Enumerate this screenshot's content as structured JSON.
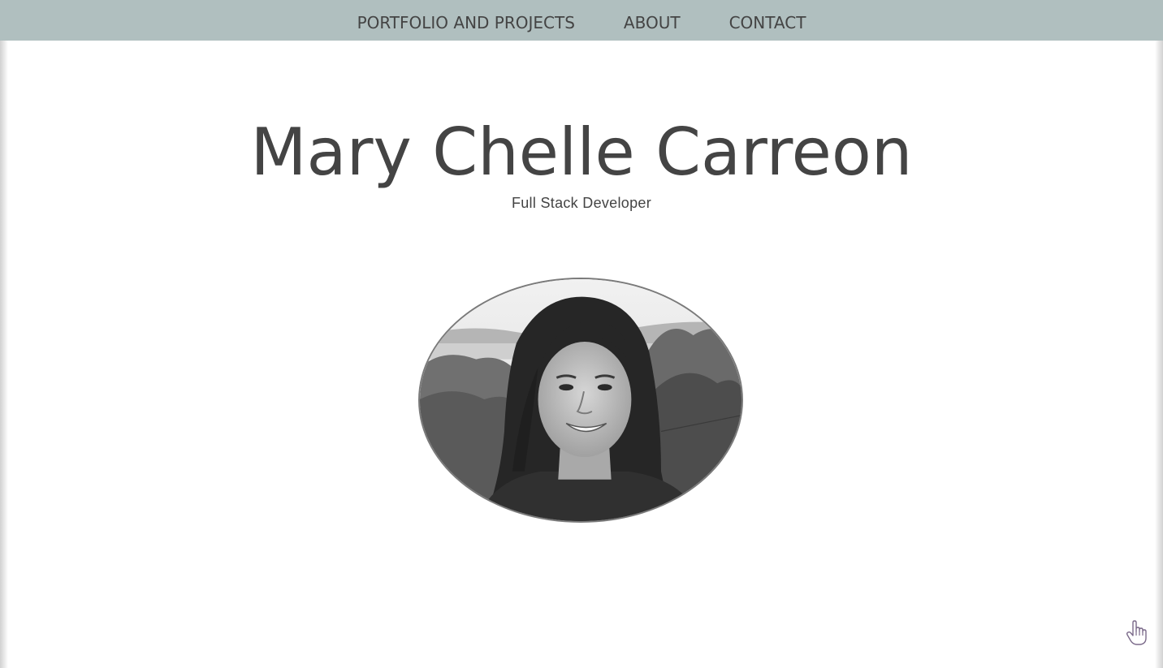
{
  "nav": {
    "items": [
      {
        "label": "PORTFOLIO AND PROJECTS"
      },
      {
        "label": "ABOUT"
      },
      {
        "label": "CONTACT"
      }
    ]
  },
  "hero": {
    "name": "Mary Chelle Carreon",
    "subtitle": "Full Stack Developer"
  },
  "profile_photo": {
    "style": "black-and-white portrait, oval frame",
    "icon": "portrait-photo"
  },
  "cursor": {
    "icon": "hand-pointer-icon"
  },
  "colors": {
    "navbar_bg": "#b0bfbf",
    "text": "#444444",
    "page_bg": "#ffffff",
    "photo_border": "#7a7a7a"
  }
}
